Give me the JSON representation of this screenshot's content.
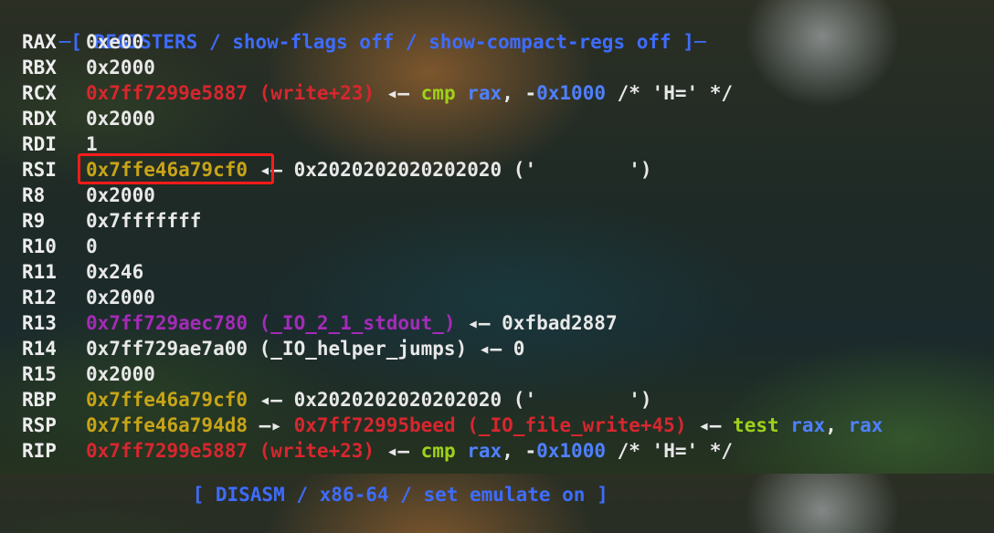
{
  "header": {
    "text": "─[ REGISTERS / show-flags off / show-compact-regs off ]─"
  },
  "registers": [
    {
      "name": "RAX",
      "parts": [
        {
          "text": "0xe00",
          "color": "white"
        }
      ]
    },
    {
      "name": "RBX",
      "parts": [
        {
          "text": "0x2000",
          "color": "white"
        }
      ]
    },
    {
      "name": "RCX",
      "parts": [
        {
          "text": "0x7ff7299e5887 (write+23)",
          "color": "red"
        },
        {
          "text": " ◂— ",
          "color": "white"
        },
        {
          "text": "cmp",
          "color": "green"
        },
        {
          "text": " ",
          "color": "white"
        },
        {
          "text": "rax",
          "color": "blue"
        },
        {
          "text": ", -",
          "color": "white"
        },
        {
          "text": "0x1000",
          "color": "blue"
        },
        {
          "text": " /* 'H=' */",
          "color": "white"
        }
      ]
    },
    {
      "name": "RDX",
      "parts": [
        {
          "text": "0x2000",
          "color": "white"
        }
      ]
    },
    {
      "name": "RDI",
      "parts": [
        {
          "text": "1",
          "color": "white"
        }
      ]
    },
    {
      "name": "RSI",
      "parts": [
        {
          "text": "0x7ffe46a79cf0",
          "color": "yellow"
        },
        {
          "text": " ◂— 0x2020202020202020 ('        ')",
          "color": "white"
        }
      ]
    },
    {
      "name": "R8",
      "parts": [
        {
          "text": "0x2000",
          "color": "white"
        }
      ]
    },
    {
      "name": "R9",
      "parts": [
        {
          "text": "0x7fffffff",
          "color": "white"
        }
      ]
    },
    {
      "name": "R10",
      "parts": [
        {
          "text": "0",
          "color": "white"
        }
      ]
    },
    {
      "name": "R11",
      "parts": [
        {
          "text": "0x246",
          "color": "white"
        }
      ]
    },
    {
      "name": "R12",
      "parts": [
        {
          "text": "0x2000",
          "color": "white"
        }
      ]
    },
    {
      "name": "R13",
      "parts": [
        {
          "text": "0x7ff729aec780 (_IO_2_1_stdout_)",
          "color": "purple"
        },
        {
          "text": " ◂— 0xfbad2887",
          "color": "white"
        }
      ]
    },
    {
      "name": "R14",
      "parts": [
        {
          "text": "0x7ff729ae7a00 (_IO_helper_jumps) ◂— 0",
          "color": "white"
        }
      ]
    },
    {
      "name": "R15",
      "parts": [
        {
          "text": "0x2000",
          "color": "white"
        }
      ]
    },
    {
      "name": "RBP",
      "parts": [
        {
          "text": "0x7ffe46a79cf0",
          "color": "yellow"
        },
        {
          "text": " ◂— 0x2020202020202020 ('        ')",
          "color": "white"
        }
      ]
    },
    {
      "name": "RSP",
      "parts": [
        {
          "text": "0x7ffe46a794d8",
          "color": "yellow"
        },
        {
          "text": " —▸ ",
          "color": "white"
        },
        {
          "text": "0x7ff72995beed (_IO_file_write+45)",
          "color": "red"
        },
        {
          "text": " ◂— ",
          "color": "white"
        },
        {
          "text": "test",
          "color": "green"
        },
        {
          "text": " ",
          "color": "white"
        },
        {
          "text": "rax",
          "color": "blue"
        },
        {
          "text": ", ",
          "color": "white"
        },
        {
          "text": "rax",
          "color": "blue"
        }
      ]
    },
    {
      "name": "RIP",
      "parts": [
        {
          "text": "0x7ff7299e5887 (write+23)",
          "color": "red"
        },
        {
          "text": " ◂— ",
          "color": "white"
        },
        {
          "text": "cmp",
          "color": "green"
        },
        {
          "text": " ",
          "color": "white"
        },
        {
          "text": "rax",
          "color": "blue"
        },
        {
          "text": ", -",
          "color": "white"
        },
        {
          "text": "0x1000",
          "color": "blue"
        },
        {
          "text": " /* 'H=' */",
          "color": "white"
        }
      ]
    }
  ],
  "footer_partial": {
    "text": "[ DISASM / x86-64 / set emulate on ]"
  },
  "highlight": {
    "color": "#ff1b1b"
  },
  "colors": {
    "white": "#e8e8e8",
    "red": "#d8262e",
    "yellow": "#c8a417",
    "purple": "#a42bb8",
    "green": "#9fd11a",
    "blue": "#4f80ff",
    "header": "#2b5bff"
  }
}
